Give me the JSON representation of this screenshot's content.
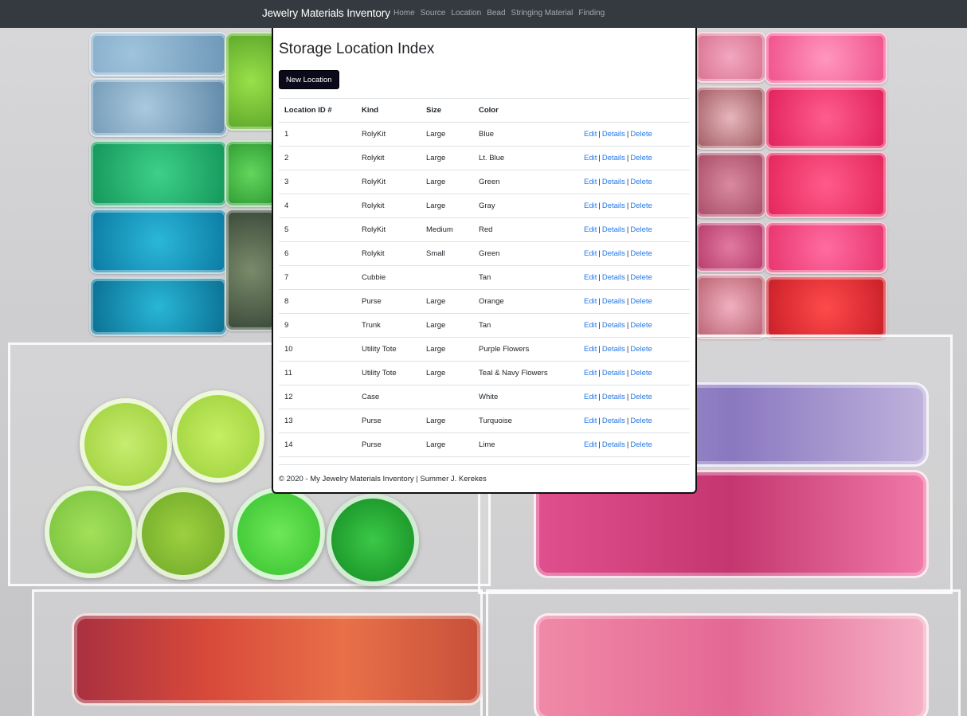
{
  "app": {
    "brand": "Jewelry Materials Inventory"
  },
  "nav": {
    "items": [
      {
        "label": "Home"
      },
      {
        "label": "Source"
      },
      {
        "label": "Location"
      },
      {
        "label": "Bead"
      },
      {
        "label": "Stringing Material"
      },
      {
        "label": "Finding"
      }
    ]
  },
  "page": {
    "title": "Storage Location Index",
    "new_button": "New Location"
  },
  "table": {
    "headers": {
      "id": "Location ID #",
      "kind": "Kind",
      "size": "Size",
      "color": "Color"
    },
    "action_labels": {
      "edit": "Edit",
      "details": "Details",
      "delete": "Delete",
      "separator": "|"
    },
    "rows": [
      {
        "id": "1",
        "kind": "RolyKit",
        "size": "Large",
        "color": "Blue"
      },
      {
        "id": "2",
        "kind": "Rolykit",
        "size": "Large",
        "color": "Lt. Blue"
      },
      {
        "id": "3",
        "kind": "RolyKit",
        "size": "Large",
        "color": "Green"
      },
      {
        "id": "4",
        "kind": "Rolykit",
        "size": "Large",
        "color": "Gray"
      },
      {
        "id": "5",
        "kind": "RolyKit",
        "size": "Medium",
        "color": "Red"
      },
      {
        "id": "6",
        "kind": "Rolykit",
        "size": "Small",
        "color": "Green"
      },
      {
        "id": "7",
        "kind": "Cubbie",
        "size": "",
        "color": "Tan"
      },
      {
        "id": "8",
        "kind": "Purse",
        "size": "Large",
        "color": "Orange"
      },
      {
        "id": "9",
        "kind": "Trunk",
        "size": "Large",
        "color": "Tan"
      },
      {
        "id": "10",
        "kind": "Utility Tote",
        "size": "Large",
        "color": "Purple Flowers"
      },
      {
        "id": "11",
        "kind": "Utility Tote",
        "size": "Large",
        "color": "Teal & Navy Flowers"
      },
      {
        "id": "12",
        "kind": "Case",
        "size": "",
        "color": "White"
      },
      {
        "id": "13",
        "kind": "Purse",
        "size": "Large",
        "color": "Turquoise"
      },
      {
        "id": "14",
        "kind": "Purse",
        "size": "Large",
        "color": "Lime"
      }
    ]
  },
  "footer": {
    "text": "© 2020 - My Jewelry Materials Inventory | Summer J. Kerekes"
  },
  "colors": {
    "navbar": "#343a40",
    "link": "#2478e8",
    "button": "#0a0a1a"
  }
}
